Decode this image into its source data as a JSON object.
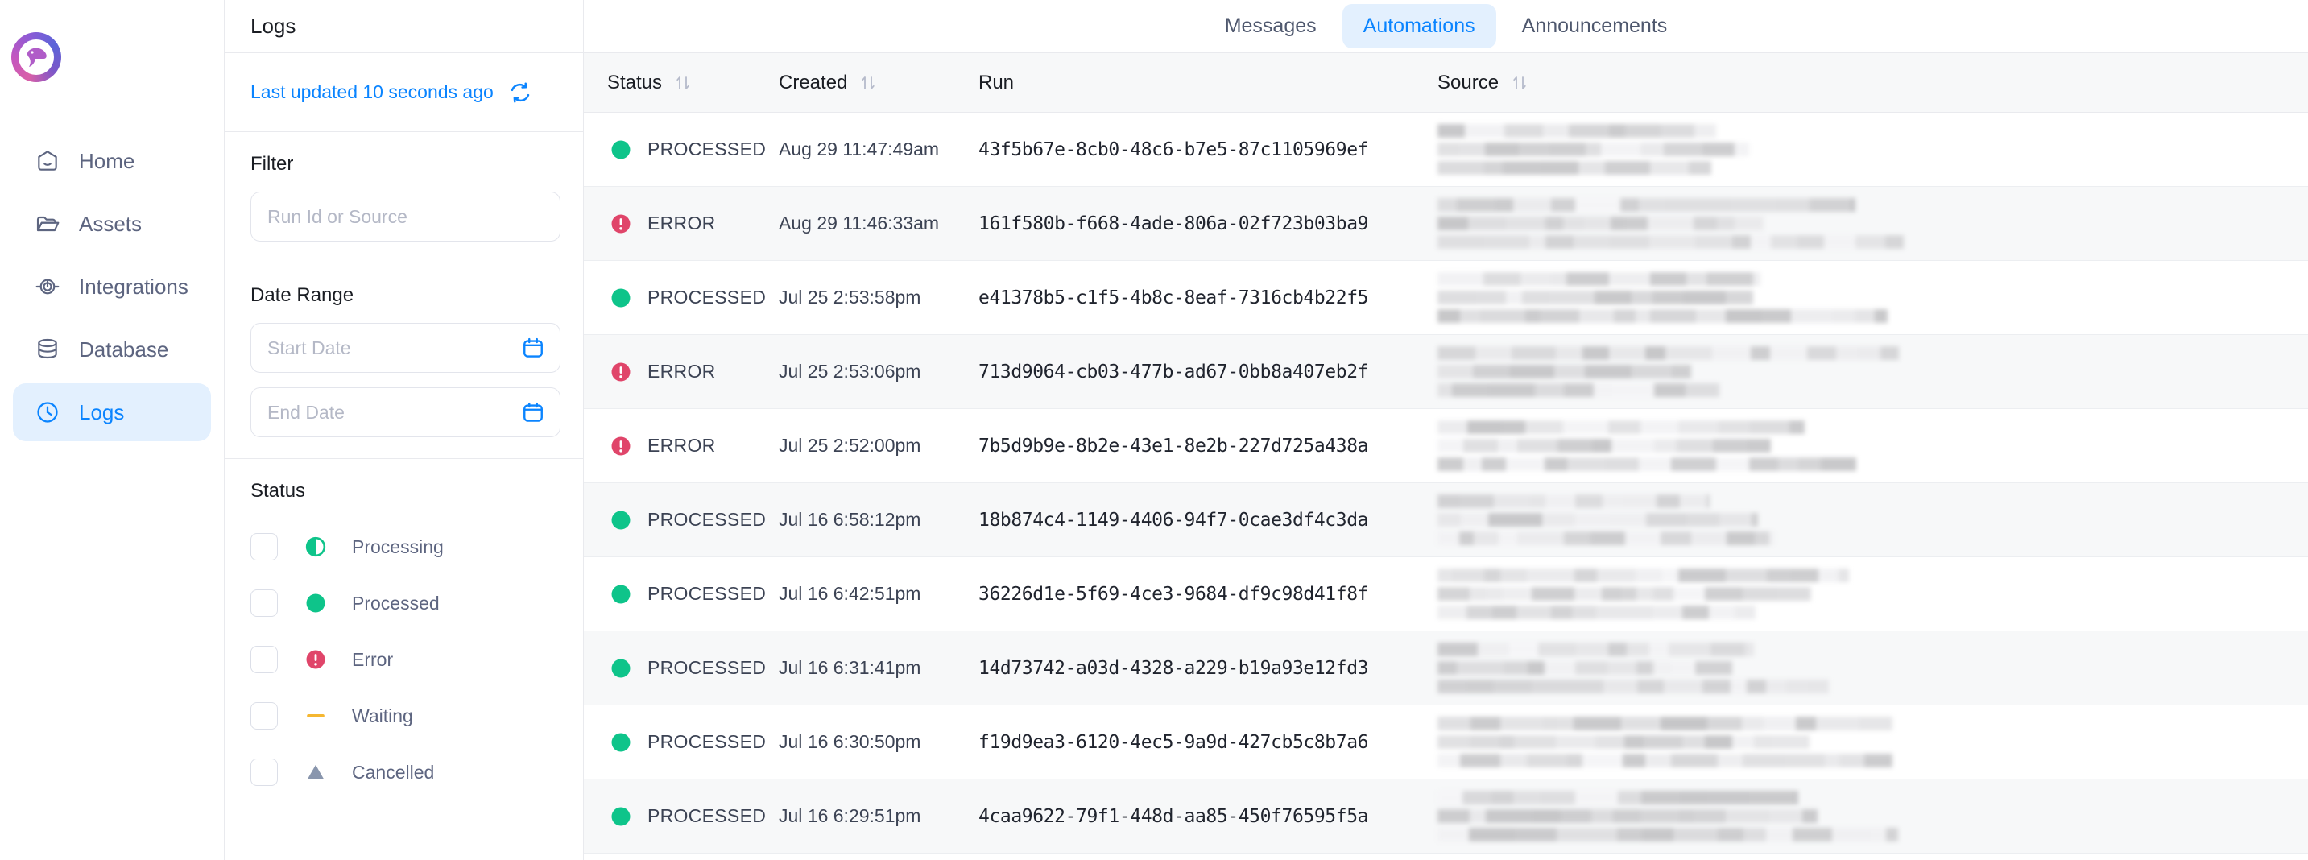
{
  "sidebar": {
    "logo_name": "bird-logo",
    "items": [
      {
        "label": "Home",
        "icon": "home-icon",
        "active": false
      },
      {
        "label": "Assets",
        "icon": "folder-icon",
        "active": false
      },
      {
        "label": "Integrations",
        "icon": "integrations-icon",
        "active": false
      },
      {
        "label": "Database",
        "icon": "database-icon",
        "active": false
      },
      {
        "label": "Logs",
        "icon": "clock-icon",
        "active": true
      }
    ]
  },
  "filters": {
    "title": "Logs",
    "last_updated": "Last updated 10 seconds ago",
    "refresh_icon": "refresh-icon",
    "filter_label": "Filter",
    "filter_placeholder": "Run Id or Source",
    "filter_value": "",
    "date_range_label": "Date Range",
    "start_date_placeholder": "Start Date",
    "start_date_value": "",
    "end_date_placeholder": "End Date",
    "end_date_value": "",
    "status_label": "Status",
    "status_options": [
      {
        "label": "Processing",
        "icon": "half-circle-icon",
        "color": "#10b981",
        "checked": false
      },
      {
        "label": "Processed",
        "icon": "filled-circle-icon",
        "color": "#0ec48a",
        "checked": false
      },
      {
        "label": "Error",
        "icon": "error-circle-icon",
        "color": "#e0456a",
        "checked": false
      },
      {
        "label": "Waiting",
        "icon": "dash-icon",
        "color": "#f5b731",
        "checked": false
      },
      {
        "label": "Cancelled",
        "icon": "triangle-icon",
        "color": "#8996ad",
        "checked": false
      }
    ]
  },
  "tabs": [
    {
      "label": "Messages",
      "active": false
    },
    {
      "label": "Automations",
      "active": true
    },
    {
      "label": "Announcements",
      "active": false
    }
  ],
  "table": {
    "columns": [
      {
        "label": "Status",
        "sortable": true
      },
      {
        "label": "Created",
        "sortable": true
      },
      {
        "label": "Run",
        "sortable": false
      },
      {
        "label": "Source",
        "sortable": true
      }
    ],
    "rows": [
      {
        "status": "PROCESSED",
        "status_color": "#0ec48a",
        "status_icon": "filled-circle-icon",
        "created": "Aug 29 11:47:49am",
        "run": "43f5b67e-8cb0-48c6-b7e5-87c1105969ef",
        "source": "redacted"
      },
      {
        "status": "ERROR",
        "status_color": "#e0456a",
        "status_icon": "error-circle-icon",
        "created": "Aug 29 11:46:33am",
        "run": "161f580b-f668-4ade-806a-02f723b03ba9",
        "source": "redacted"
      },
      {
        "status": "PROCESSED",
        "status_color": "#0ec48a",
        "status_icon": "filled-circle-icon",
        "created": "Jul 25 2:53:58pm",
        "run": "e41378b5-c1f5-4b8c-8eaf-7316cb4b22f5",
        "source": "redacted"
      },
      {
        "status": "ERROR",
        "status_color": "#e0456a",
        "status_icon": "error-circle-icon",
        "created": "Jul 25 2:53:06pm",
        "run": "713d9064-cb03-477b-ad67-0bb8a407eb2f",
        "source": "redacted"
      },
      {
        "status": "ERROR",
        "status_color": "#e0456a",
        "status_icon": "error-circle-icon",
        "created": "Jul 25 2:52:00pm",
        "run": "7b5d9b9e-8b2e-43e1-8e2b-227d725a438a",
        "source": "redacted"
      },
      {
        "status": "PROCESSED",
        "status_color": "#0ec48a",
        "status_icon": "filled-circle-icon",
        "created": "Jul 16 6:58:12pm",
        "run": "18b874c4-1149-4406-94f7-0cae3df4c3da",
        "source": "redacted"
      },
      {
        "status": "PROCESSED",
        "status_color": "#0ec48a",
        "status_icon": "filled-circle-icon",
        "created": "Jul 16 6:42:51pm",
        "run": "36226d1e-5f69-4ce3-9684-df9c98d41f8f",
        "source": "redacted"
      },
      {
        "status": "PROCESSED",
        "status_color": "#0ec48a",
        "status_icon": "filled-circle-icon",
        "created": "Jul 16 6:31:41pm",
        "run": "14d73742-a03d-4328-a229-b19a93e12fd3",
        "source": "redacted"
      },
      {
        "status": "PROCESSED",
        "status_color": "#0ec48a",
        "status_icon": "filled-circle-icon",
        "created": "Jul 16 6:30:50pm",
        "run": "f19d9ea3-6120-4ec5-9a9d-427cb5c8b7a6",
        "source": "redacted"
      },
      {
        "status": "PROCESSED",
        "status_color": "#0ec48a",
        "status_icon": "filled-circle-icon",
        "created": "Jul 16 6:29:51pm",
        "run": "4caa9622-79f1-448d-aa85-450f76595f5a",
        "source": "redacted"
      }
    ]
  },
  "colors": {
    "accent": "#0a84ff",
    "accent_bg": "#e3f0fe",
    "text": "#3c4354",
    "muted": "#b4b8c6",
    "border": "#e9eaee",
    "row_alt": "#f7f8f9",
    "green": "#0ec48a",
    "red": "#e0456a",
    "yellow": "#f5b731",
    "grey": "#8996ad"
  }
}
